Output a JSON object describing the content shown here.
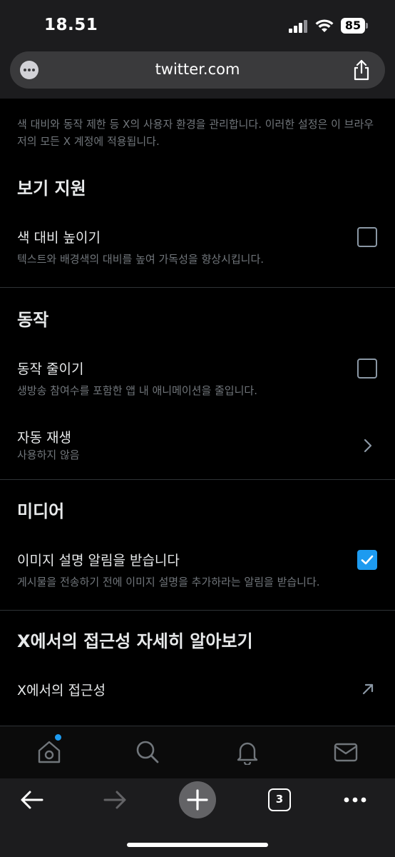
{
  "status_bar": {
    "time": "18.51",
    "battery": "85"
  },
  "browser": {
    "url": "twitter.com",
    "tabs_count": "3"
  },
  "intro_text": "색 대비와 동작 제한 등 X의 사용자 환경을 관리합니다. 이러한 설정은 이 브라우저의 모든 X 계정에 적용됩니다.",
  "sections": {
    "vision": {
      "title": "보기 지원",
      "increase_contrast": {
        "label": "색 대비 높이기",
        "description": "텍스트와 배경색의 대비를 높여 가독성을 향상시킵니다.",
        "checked": false
      }
    },
    "motion": {
      "title": "동작",
      "reduce_motion": {
        "label": "동작 줄이기",
        "description": "생방송 참여수를 포함한 앱 내 애니메이션을 줄입니다.",
        "checked": false
      },
      "autoplay": {
        "label": "자동 재생",
        "value": "사용하지 않음"
      }
    },
    "media": {
      "title": "미디어",
      "image_description_reminder": {
        "label": "이미지 설명 알림을 받습니다",
        "description": "게시물을 전송하기 전에 이미지 설명을 추가하라는 알림을 받습니다.",
        "checked": true
      }
    },
    "learn_more": {
      "title": "X에서의 접근성 자세히 알아보기",
      "link_label": "X에서의 접근성"
    }
  },
  "colors": {
    "accent": "#1d9bf0",
    "background": "#000000",
    "chrome": "#1c1c1e",
    "secondary_text": "#71767b"
  },
  "icons": {
    "tabbar": [
      "home-icon",
      "search-icon",
      "notifications-icon",
      "messages-icon"
    ],
    "toolbar": [
      "back-arrow-icon",
      "forward-arrow-icon",
      "new-tab-plus-icon",
      "tabs-icon",
      "more-icon"
    ]
  }
}
